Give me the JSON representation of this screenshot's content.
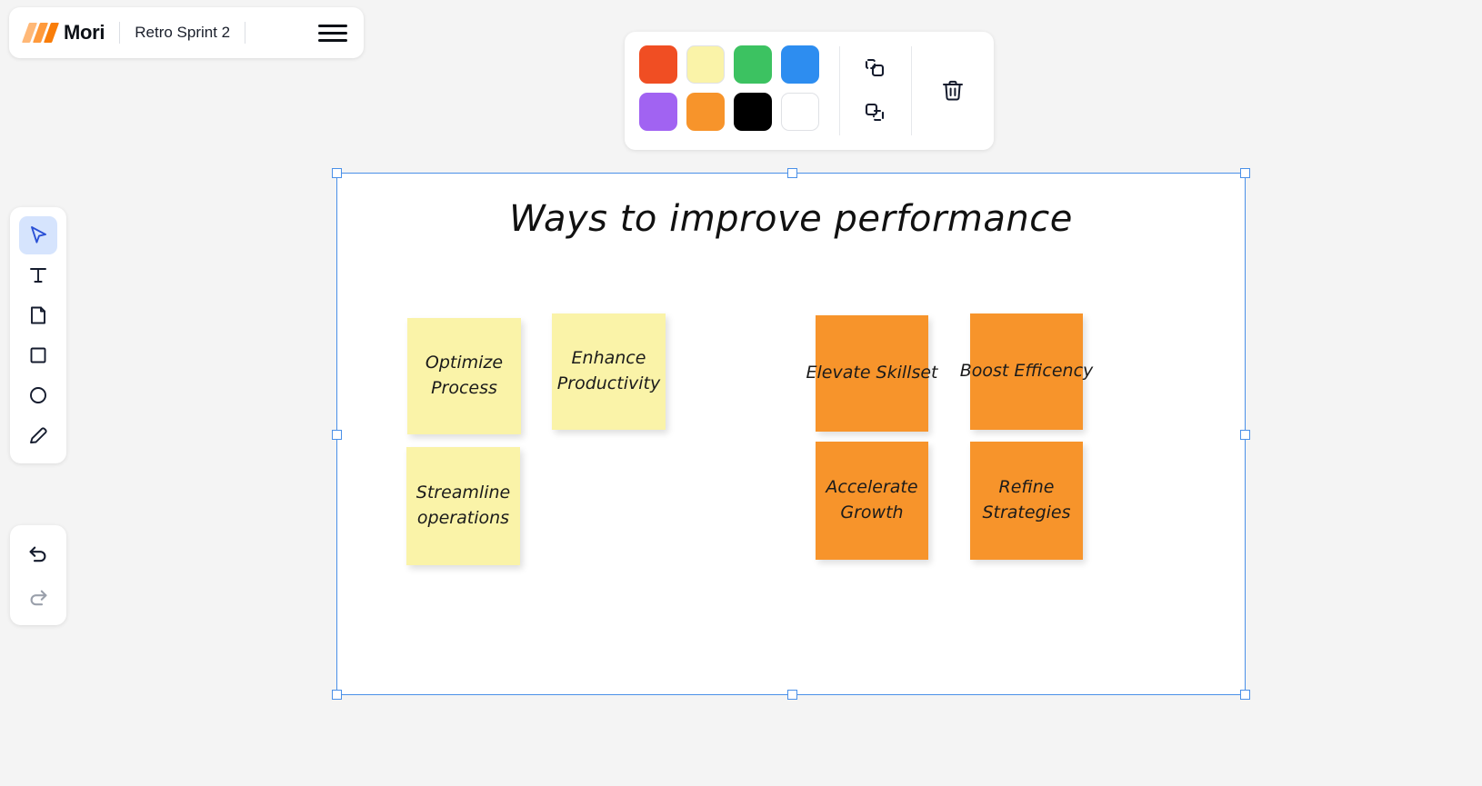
{
  "app": {
    "logo_text": "Mori",
    "board_name": "Retro Sprint 2",
    "menu_icon": "hamburger-icon"
  },
  "style_toolbar": {
    "swatches": [
      {
        "name": "swatch-red",
        "color": "#f04e23",
        "bordered": false
      },
      {
        "name": "swatch-yellow",
        "color": "#faf3a8",
        "bordered": true
      },
      {
        "name": "swatch-green",
        "color": "#3cc261",
        "bordered": false
      },
      {
        "name": "swatch-blue",
        "color": "#2d8df0",
        "bordered": false
      },
      {
        "name": "swatch-purple",
        "color": "#a濫",
        "bordered": false
      },
      {
        "name": "swatch-orange",
        "color": "#f7942b",
        "bordered": false
      },
      {
        "name": "swatch-black",
        "color": "#000000",
        "bordered": false
      },
      {
        "name": "swatch-white",
        "color": "#ffffff",
        "bordered": true
      }
    ],
    "group_label": "group-icon",
    "ungroup_label": "ungroup-icon",
    "delete_label": "trash-icon"
  },
  "tool_rail": {
    "tools": [
      {
        "name": "tool-select",
        "icon": "cursor-icon",
        "active": true
      },
      {
        "name": "tool-text",
        "icon": "text-icon",
        "active": false
      },
      {
        "name": "tool-note",
        "icon": "note-icon",
        "active": false
      },
      {
        "name": "tool-rectangle",
        "icon": "square-icon",
        "active": false
      },
      {
        "name": "tool-ellipse",
        "icon": "circle-icon",
        "active": false
      },
      {
        "name": "tool-pen",
        "icon": "pencil-icon",
        "active": false
      }
    ],
    "history": [
      {
        "name": "undo-button",
        "icon": "undo-icon",
        "enabled": true
      },
      {
        "name": "redo-button",
        "icon": "redo-icon",
        "enabled": false
      }
    ]
  },
  "board": {
    "title": "Ways to improve performance",
    "notes": [
      {
        "id": "note-optimize",
        "text": "Optimize\nProcess",
        "color": "#faf3a8"
      },
      {
        "id": "note-enhance",
        "text": "Enhance\nProductivity",
        "color": "#faf3a8"
      },
      {
        "id": "note-streamline",
        "text": "Streamline\noperations",
        "color": "#faf3a8"
      },
      {
        "id": "note-elevate",
        "text": "Elevate Skillset",
        "color": "#f7942b"
      },
      {
        "id": "note-boost",
        "text": "Boost Efficency",
        "color": "#f7942b"
      },
      {
        "id": "note-accelerate",
        "text": "Accelerate\nGrowth",
        "color": "#f7942b"
      },
      {
        "id": "note-refine",
        "text": "Refine\nStrategies",
        "color": "#f7942b"
      }
    ]
  },
  "colors": {
    "accent": "#4a90e8",
    "brand_orange": "#f97d09",
    "canvas_bg": "#f4f4f4"
  }
}
